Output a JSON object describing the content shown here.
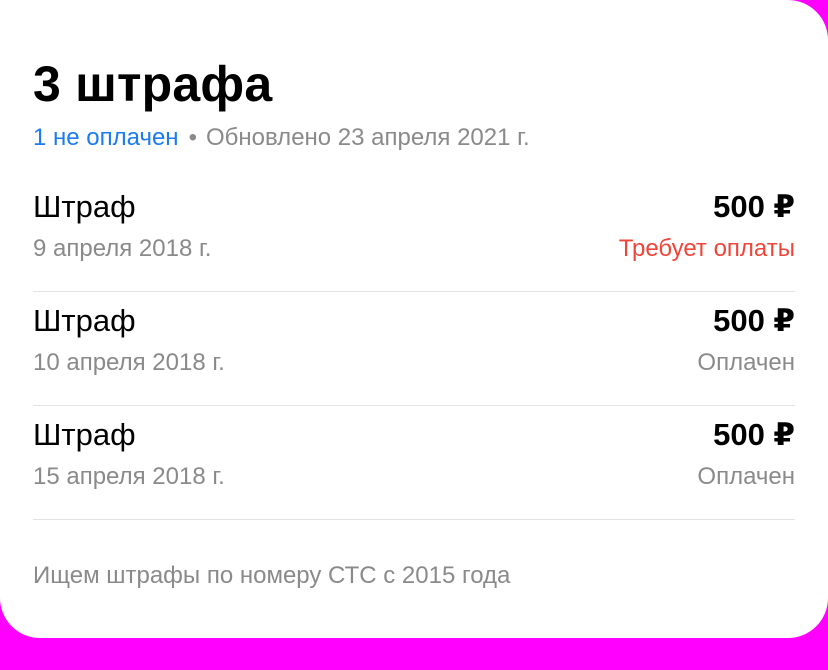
{
  "header": {
    "title": "3 штрафа",
    "unpaid_label": "1 не оплачен",
    "separator": "•",
    "updated_label": "Обновлено 23 апреля 2021 г."
  },
  "fines": [
    {
      "name": "Штраф",
      "amount": "500 ₽",
      "date": "9 апреля 2018 г.",
      "status": "Требует оплаты",
      "status_type": "due"
    },
    {
      "name": "Штраф",
      "amount": "500 ₽",
      "date": "10 апреля 2018 г.",
      "status": "Оплачен",
      "status_type": "paid"
    },
    {
      "name": "Штраф",
      "amount": "500 ₽",
      "date": "15 апреля 2018 г.",
      "status": "Оплачен",
      "status_type": "paid"
    }
  ],
  "footer": {
    "note": "Ищем штрафы по номеру СТС с 2015 года"
  },
  "colors": {
    "accent": "#1a7cf0",
    "due": "#f0453a",
    "muted": "#8a8a8a",
    "background": "#ff00ff"
  }
}
